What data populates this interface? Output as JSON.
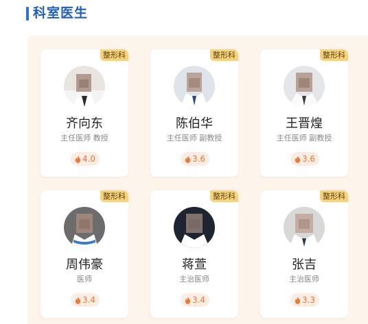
{
  "header": {
    "title": "科室医生"
  },
  "accent_color": "#2f6fd6",
  "tag_color": "#f6d37a",
  "score_color": "#e8793d",
  "doctors": [
    {
      "tag": "整形科",
      "name": "齐向东",
      "title": "主任医师 教授",
      "rating": "4.0",
      "icon": "fire-icon"
    },
    {
      "tag": "整形科",
      "name": "陈伯华",
      "title": "主任医师 副教授",
      "rating": "3.6",
      "icon": "fire-icon"
    },
    {
      "tag": "整形科",
      "name": "王晋煌",
      "title": "主任医师 副教授",
      "rating": "3.6",
      "icon": "fire-icon"
    },
    {
      "tag": "整形科",
      "name": "周伟豪",
      "title": "医师",
      "rating": "3.4",
      "icon": "fire-icon"
    },
    {
      "tag": "整形科",
      "name": "蒋萱",
      "title": "主治医师",
      "rating": "3.4",
      "icon": "fire-icon"
    },
    {
      "tag": "整形科",
      "name": "张吉",
      "title": "主治医师",
      "rating": "3.3",
      "icon": "fire-icon"
    }
  ]
}
